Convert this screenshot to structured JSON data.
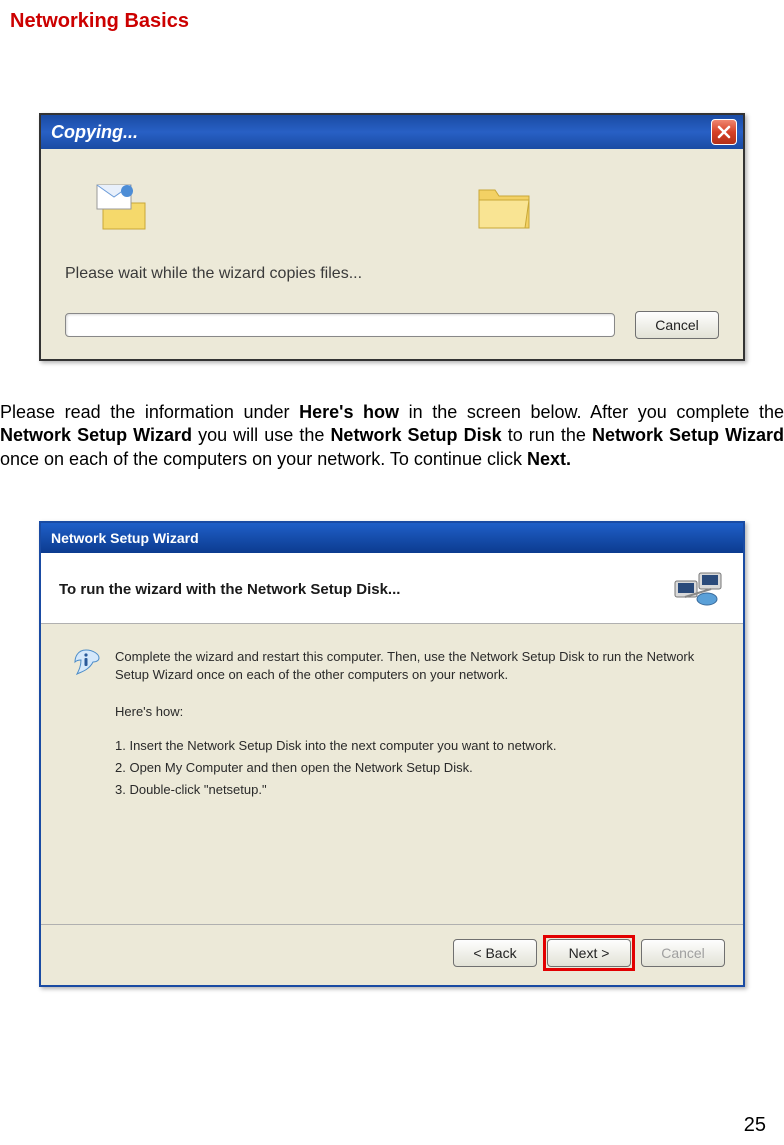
{
  "page_title": "Networking Basics",
  "dialog1": {
    "title": "Copying...",
    "message": "Please wait while the wizard copies files...",
    "cancel_label": "Cancel"
  },
  "instructions": {
    "p1a": "Please read the information under ",
    "b1": "Here's how",
    "p1b": " in the screen below.  After you complete the ",
    "b2": "Network Setup Wizard",
    "p1c": " you will use the ",
    "b3": "Network Setup Disk",
    "p1d": " to run the ",
    "b4": "Network Setup Wizard",
    "p1e": " once on each of the computers on your network.  To continue click ",
    "b5": "Next.",
    "p1f": ""
  },
  "dialog2": {
    "title": "Network Setup Wizard",
    "header_title": "To run the wizard with the Network Setup Disk...",
    "intro": "Complete the wizard and restart this computer. Then, use the Network Setup Disk to run the Network Setup Wizard once on each of the other computers on your network.",
    "hereshow": "Here's how:",
    "step1": "1.  Insert the Network Setup Disk into the next computer you want to network.",
    "step2": "2.  Open My Computer and then open the Network Setup Disk.",
    "step3": "3.  Double-click \"netsetup.\"",
    "back_label": "< Back",
    "next_label": "Next >",
    "cancel_label": "Cancel"
  },
  "page_number": "25"
}
